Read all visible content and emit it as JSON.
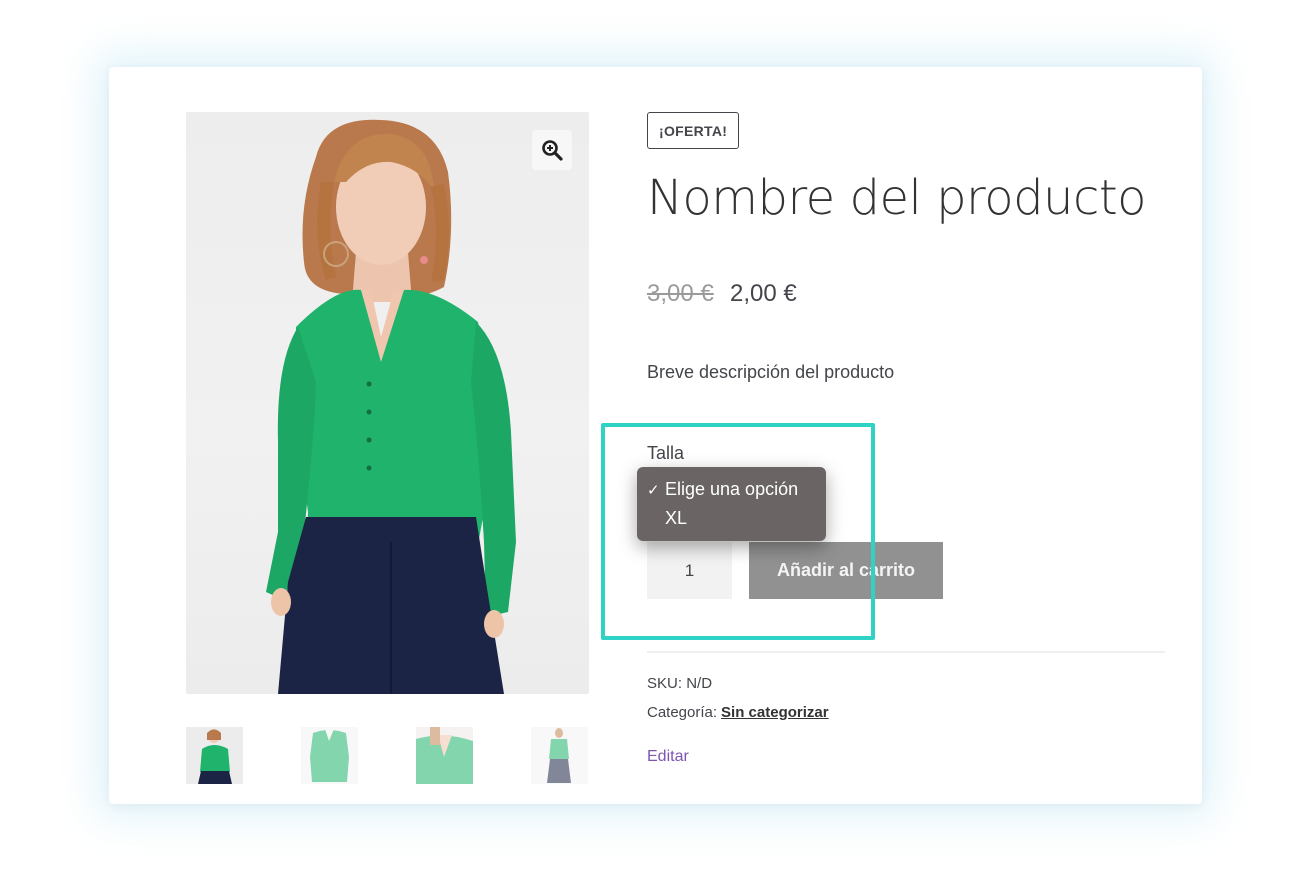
{
  "product": {
    "badge": "¡OFERTA!",
    "title": "Nombre del producto",
    "price_old": "3,00 €",
    "price_new": "2,00 €",
    "short_description": "Breve descripción del producto"
  },
  "variation": {
    "label": "Talla",
    "options": [
      {
        "check": "✓",
        "label": "Elige una opción",
        "selected": true
      },
      {
        "check": "",
        "label": "XL",
        "selected": false
      }
    ]
  },
  "cart": {
    "quantity": "1",
    "add_label": "Añadir al carrito"
  },
  "meta": {
    "sku_label": "SKU:",
    "sku_value": "N/D",
    "category_label": "Categoría:",
    "category_value": "Sin categorizar",
    "edit_label": "Editar"
  },
  "icons": {
    "zoom": "magnifier-plus-icon"
  },
  "colors": {
    "highlight": "#2fd3c5",
    "shirt": "#1fb36b",
    "pants": "#1c2446",
    "button": "#919191",
    "link": "#7f54b3"
  }
}
